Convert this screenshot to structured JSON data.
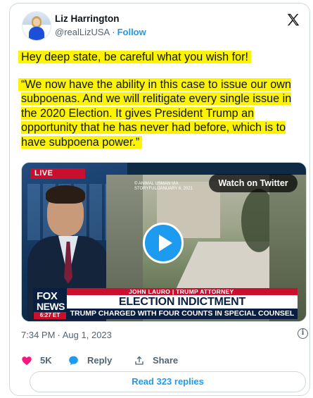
{
  "author": {
    "name": "Liz Harrington",
    "handle": "@realLizUSA",
    "separator": "·",
    "follow_label": "Follow"
  },
  "tweet": {
    "line1": "Hey deep state, be careful what you wish for!",
    "quote": "“We now have the ability in this case to issue our own subpoenas. And we will relitigate every single issue in the 2020 Election. It gives President Trump an opportunity that he has never had before, which is to have subpoena power.”",
    "highlight_color": "#fcf400"
  },
  "media": {
    "live_badge": "LIVE",
    "watch_label": "Watch on Twitter",
    "credit_line1": "© ANIMAL USMAN VIA",
    "credit_line2": "STORYFUL/JANUARY 6, 2021",
    "network_line1": "FOX",
    "network_line2": "NEWS",
    "clock": "6:27 ET",
    "name_strip": "JOHN LAURO | TRUMP ATTORNEY",
    "headline": "ELECTION INDICTMENT",
    "subline": "TRUMP CHARGED WITH FOUR COUNTS IN SPECIAL COUNSEL CASE"
  },
  "meta": {
    "time": "7:34 PM",
    "separator": "·",
    "date": "Aug 1, 2023",
    "info_glyph": "i"
  },
  "actions": {
    "likes": "5K",
    "reply_label": "Reply",
    "share_label": "Share"
  },
  "read_replies_label": "Read 323 replies",
  "colors": {
    "accent": "#1d9bf0",
    "like": "#f91880",
    "muted": "#536471",
    "border": "#cfd9de"
  },
  "icons": [
    "x-logo-icon",
    "play-icon",
    "info-icon",
    "heart-icon",
    "reply-bubble-icon",
    "share-icon"
  ]
}
